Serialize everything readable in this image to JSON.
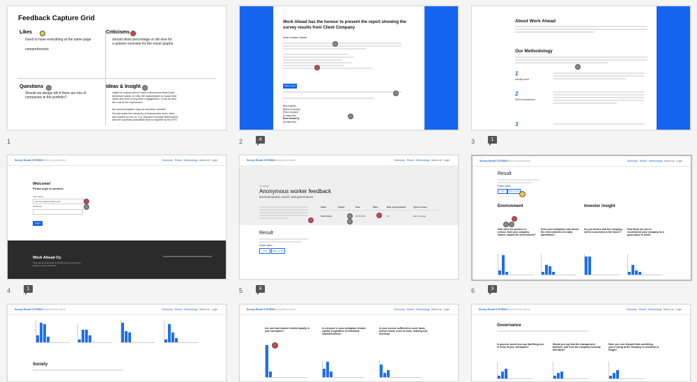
{
  "slides": [
    {
      "num": "1",
      "title": "Feedback Capture Grid",
      "likes": {
        "title": "Likes",
        "items": [
          "Good to have everything at the same page",
          "comprehensive"
        ]
      },
      "criticisms": {
        "title": "Criticisms",
        "items": [
          "should show percentage or sth else for a quicker overview for the result graphs"
        ]
      },
      "questions": {
        "title": "Questions",
        "items": [
          "Should we design sth if there are lots of companies in the portfolio?"
        ]
      },
      "ideas": {
        "title": "Ideas & Insight",
        "items": [
          "might be a good idea to have a discussion board and feedback button, to help the stakeholders to share their ideas and form a long-term engagement. It can be also the root of the experiment",
          "the account system may be therefore needed",
          "Should make the hierarchy of frameworks more clear and explicit on the ur. E.g. Equator Principle frameworks and the summary standards that is required by the EPs"
        ]
      }
    },
    {
      "num": "2",
      "comments": "4",
      "heading": "Work Ahead has the honour to present the report showing the survey results from Client Company",
      "greeting": "Dear Investor Name,",
      "cta": "Show report",
      "sign": [
        "Best regards,",
        "[Name of sender]",
        "[Title of sender]",
        "[Contact info]",
        "Work Ahead Oy",
        "[Contact info]"
      ]
    },
    {
      "num": "3",
      "comments": "1",
      "about": "About Work Ahead",
      "method": "Our Methodology",
      "steps": [
        {
          "n": "1",
          "label": "Identify need"
        },
        {
          "n": "2",
          "label": "Select frameworks"
        },
        {
          "n": "3",
          "label": ""
        }
      ]
    },
    {
      "num": "4",
      "comments": "1",
      "brand": "Survey Result #7375001",
      "sub": "Certified by Work Ahead",
      "links": "Summary · Result · Methodology",
      "acct": "About Us · Login",
      "welcome": "Welcome!",
      "login_msg": "Please login to continue.",
      "user_label": "User Name",
      "user_value": "username@username.mail",
      "pass_label": "Password",
      "login_btn": "Login",
      "footer_brand": "Work Ahead Oy",
      "footer_text": "There are company/work to benefit everyone. We know. Tempus, an sed nulla libero."
    },
    {
      "num": "5",
      "comments": "4",
      "brand": "Survey Result #7375001",
      "sub": "Certifying Work Ahead",
      "links": "Summary · Result · Methodology",
      "acct": "About Us · Login",
      "tag": "ACCURED",
      "title": "Anonymous worker feedback",
      "subtitle": "Environmental, social, and governance",
      "table_headers": [
        "Client",
        "Project",
        "Time",
        "Place",
        "Num of respondents",
        "Type of survey"
      ],
      "table_row": [
        "Client Name",
        "",
        "30.03.2019",
        "",
        "10",
        "like Pst Lolsay"
      ],
      "result": "Result",
      "export": "Export option",
      "btn1": "CSV",
      "btn2": "PDF (.xi.xb)"
    },
    {
      "num": "6",
      "comments": "3",
      "brand": "Survey Result #7375001",
      "sub": "Certified by Work Ahead",
      "links": "Summary · Result · Methodology",
      "acct": "About Us · Login",
      "result": "Result",
      "export": "Export option",
      "btn1": "CSV",
      "btn2": "PDF (.xi.xb)",
      "env": "Environment",
      "inv": "Investor insight",
      "questions": [
        "How does the product or service, that your company makes, impact the environment?",
        "Does your workplace care about the environment in its daily operations?",
        "Do you believe that the company will be successful in the future?",
        "How likely are you to recommend your company as a good place to work?"
      ]
    },
    {
      "num": "7",
      "brand": "Survey Result #7375001",
      "sub": "Certified by Work Ahead",
      "links": "Summary · Result · Methodology",
      "acct": "About Us · Login",
      "society": "Society"
    },
    {
      "num": "8",
      "brand": "Survey Result #7375001",
      "sub": "Certifying Work Ahead",
      "links": "Summary · Result · Methodology",
      "acct": "About Us · Login",
      "questions": [
        "Are men and women treated equally in your workplace?",
        "Is everyone in your workplace treated equally (regardless of individual characteristics)?",
        "Is your income sufficient to cover basic human needs, such as food, clothing and housing?"
      ]
    },
    {
      "num": "9",
      "brand": "Survey Result #7375001",
      "sub": "Certified by Work Ahead",
      "links": "Summary · Result · Methodology",
      "acct": "About Us · Login",
      "governance": "Governance",
      "questions": [
        "In general, would you say that things are in order at your workplace?",
        "Would you say that the management behaves, and runs the company honestly and fairly?",
        "Have you ever thought that something you're doing at the company is unethical or illegal?"
      ]
    }
  ],
  "colors": {
    "accent": "#1565f0",
    "red_dot": "#d94040",
    "yellow_dot": "#e8c54a"
  }
}
